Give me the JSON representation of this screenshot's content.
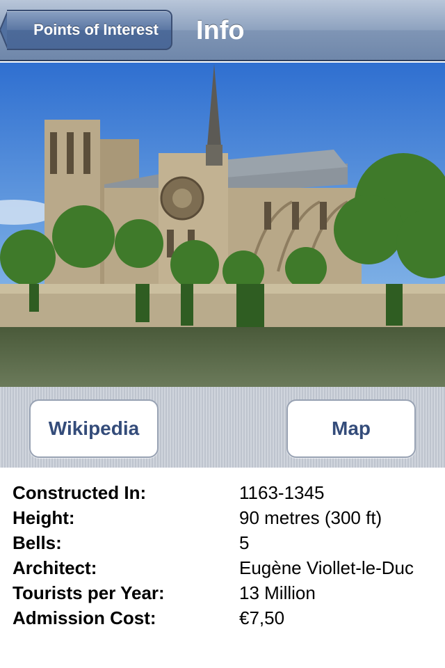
{
  "navbar": {
    "back_label": "Points of Interest",
    "title": "Info"
  },
  "photo": {
    "subject": "photo-notre-dame"
  },
  "buttons": {
    "wikipedia_label": "Wikipedia",
    "map_label": "Map"
  },
  "info": [
    {
      "label": "Constructed In:",
      "value": "1163-1345"
    },
    {
      "label": "Height:",
      "value": "90 metres (300 ft)"
    },
    {
      "label": "Bells:",
      "value": "5"
    },
    {
      "label": "Architect:",
      "value": "Eugène Viollet-le-Duc"
    },
    {
      "label": "Tourists per Year:",
      "value": "13 Million"
    },
    {
      "label": "Admission Cost:",
      "value": "€7,50"
    }
  ],
  "colors": {
    "nav_bar": "#7f95b5",
    "button_text": "#344c7a",
    "strip_background": "#c6ccd6"
  }
}
